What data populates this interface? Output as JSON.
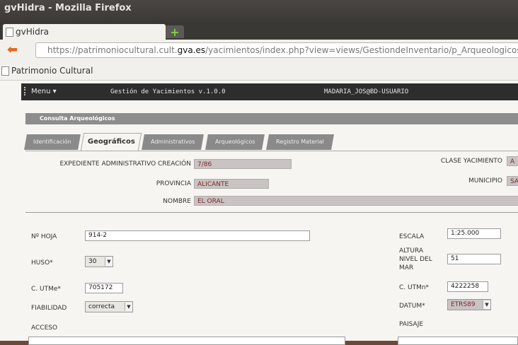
{
  "window": {
    "title": "gvHidra - Mozilla Firefox"
  },
  "browser": {
    "tab_title": "gvHidra",
    "new_tab_symbol": "+",
    "url_prefix": "https://patrimoniocultural.cult.",
    "url_domain": "gva.es",
    "url_rest": "/yacimientos/index.php?view=views/GestiondeInventario/p_ArqueologicosC",
    "bookmark": "Patrimonio Cultural"
  },
  "app": {
    "menu_label": "Menu ▾",
    "version_text": "Gestión de Yacimientos  v.1.0.0",
    "user_text": "MADARIA_JOS@BD-USUARIO"
  },
  "panel": {
    "title": "Consulta Arqueológicos",
    "tabs": [
      "Identificación",
      "Geográficos",
      "Administrativos",
      "Arqueológicos",
      "Registro Material"
    ]
  },
  "header_fields": {
    "expediente_label": "EXPEDIENTE ADMINISTRATIVO CREACIÓN",
    "expediente_value": "7/86",
    "clase_label": "CLASE YACIMIENTO",
    "clase_value": "A",
    "provincia_label": "PROVINCIA",
    "provincia_value": "ALICANTE",
    "municipio_label": "MUNICIPIO",
    "municipio_value": "SA",
    "nombre_label": "NOMBRE",
    "nombre_value": "EL ORAL"
  },
  "geo_fields": {
    "hoja_label": "Nº HOJA",
    "hoja_value": "914-2",
    "escala_label": "ESCALA",
    "escala_value": "1:25.000",
    "huso_label": "HUSO*",
    "huso_value": "30",
    "altura_label_1": "ALTURA",
    "altura_label_2": "NIVEL DEL",
    "altura_label_3": "MAR",
    "altura_value": "51",
    "utme_label": "C. UTMe*",
    "utme_value": "705172",
    "utmn_label": "C. UTMn*",
    "utmn_value": "4222258",
    "fiabilidad_label": "FIABILIDAD",
    "fiabilidad_value": "correcta",
    "datum_label": "DATUM*",
    "datum_value": "ETRS89",
    "acceso_label": "ACCESO",
    "paisaje_label": "PAISAJE"
  }
}
